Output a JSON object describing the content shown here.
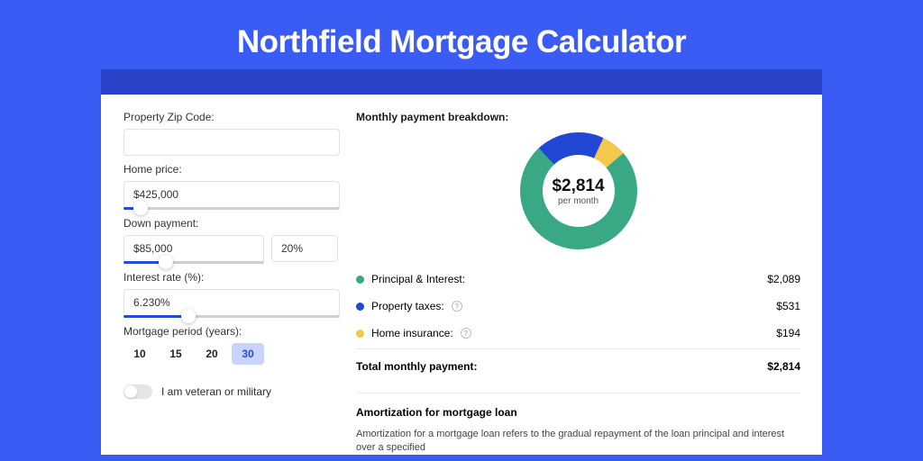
{
  "title": "Northfield Mortgage Calculator",
  "form": {
    "zip_label": "Property Zip Code:",
    "zip_value": "",
    "home_price_label": "Home price:",
    "home_price_value": "$425,000",
    "home_price_slider_pct": 8,
    "down_payment_label": "Down payment:",
    "down_payment_amount": "$85,000",
    "down_payment_pct": "20%",
    "down_payment_slider_pct": 30,
    "interest_label": "Interest rate (%):",
    "interest_value": "6.230%",
    "interest_slider_pct": 30,
    "period_label": "Mortgage period (years):",
    "period_options": [
      "10",
      "15",
      "20",
      "30"
    ],
    "period_selected": "30",
    "veteran_label": "I am veteran or military"
  },
  "breakdown": {
    "title": "Monthly payment breakdown:",
    "center_value": "$2,814",
    "center_label": "per month",
    "items": [
      {
        "label": "Principal & Interest:",
        "value": "$2,089",
        "color": "green",
        "help": false
      },
      {
        "label": "Property taxes:",
        "value": "$531",
        "color": "blue",
        "help": true
      },
      {
        "label": "Home insurance:",
        "value": "$194",
        "color": "yellow",
        "help": true
      }
    ],
    "total_label": "Total monthly payment:",
    "total_value": "$2,814"
  },
  "chart_data": {
    "type": "pie",
    "title": "Monthly payment breakdown",
    "series": [
      {
        "name": "Principal & Interest",
        "value": 2089,
        "color": "#39a885"
      },
      {
        "name": "Property taxes",
        "value": 531,
        "color": "#2347D5"
      },
      {
        "name": "Home insurance",
        "value": 194,
        "color": "#f2c94c"
      }
    ],
    "total": 2814,
    "center_label": "per month"
  },
  "amortization": {
    "title": "Amortization for mortgage loan",
    "text": "Amortization for a mortgage loan refers to the gradual repayment of the loan principal and interest over a specified"
  }
}
